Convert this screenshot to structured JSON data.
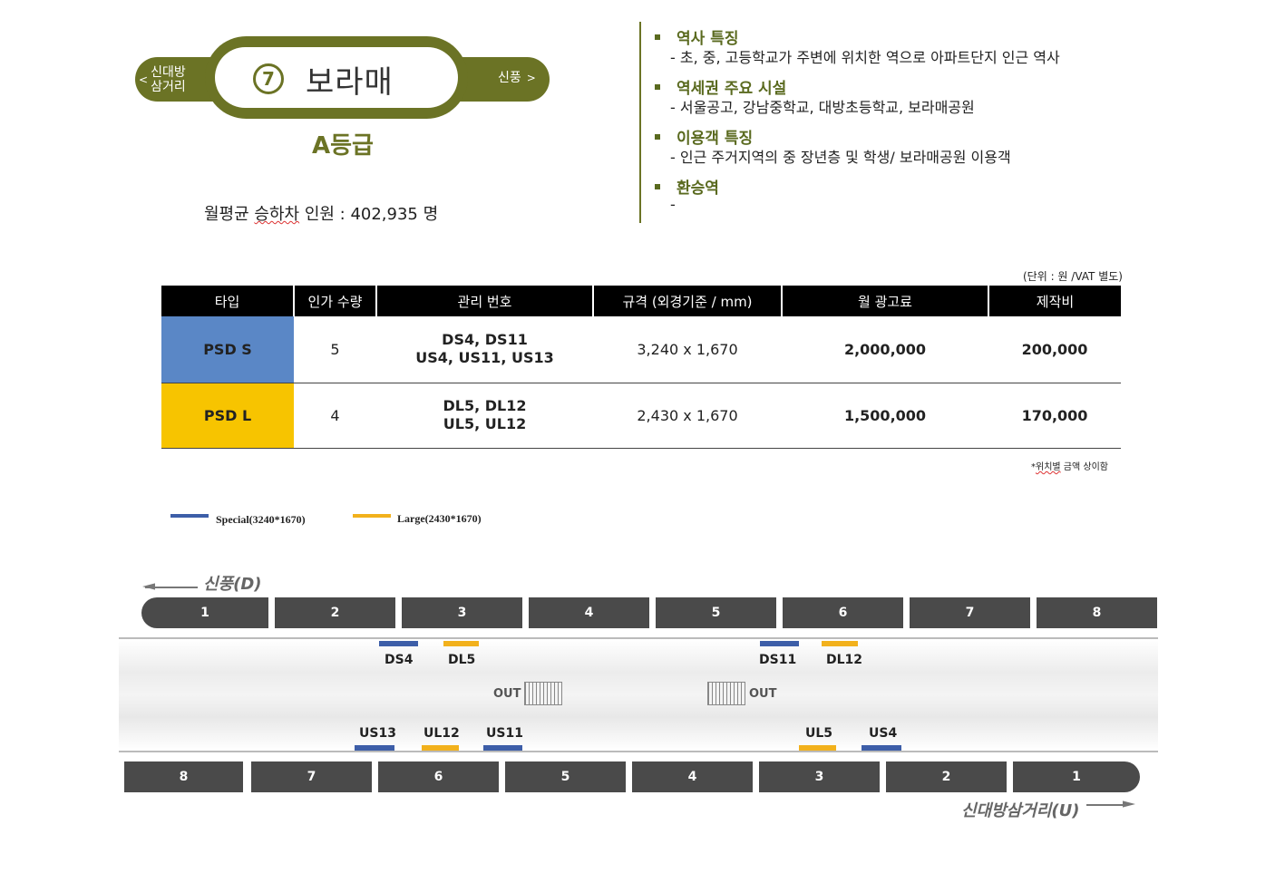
{
  "station": {
    "prev": [
      "신대방",
      "삼거리"
    ],
    "next": "신풍",
    "line_number": "7",
    "name": "보라매",
    "grade": "A등급",
    "monthly_label_pre": "월평균 ",
    "monthly_label_mid": "승하차",
    "monthly_label_post": " 인원 : 402,935 명",
    "line_color": "#6b7325"
  },
  "info": {
    "sections": [
      {
        "title": "역사 특징",
        "body": "-  초, 중, 고등학교가 주변에 위치한 역으로 아파트단지 인근 역사"
      },
      {
        "title": "역세권 주요 시설",
        "body": "-  서울공고, 강남중학교, 대방초등학교, 보라매공원"
      },
      {
        "title": "이용객 특징",
        "body": "-  인근 주거지역의 중 장년층 및 학생/ 보라매공원 이용객"
      },
      {
        "title": "환승역",
        "body": "-"
      }
    ]
  },
  "table": {
    "unit_note": "(단위 : 원 /VAT 별도)",
    "headers": [
      "타입",
      "인가 수량",
      "관리 번호",
      "규격 (외경기준 / mm)",
      "월 광고료",
      "제작비"
    ],
    "rows": [
      {
        "type": "PSD S",
        "qty": "5",
        "mgmt_1": "DS4, DS11",
        "mgmt_2": "US4, US11, US13",
        "size": "3,240 x 1,670",
        "monthly": "2,000,000",
        "production": "200,000",
        "color": "#5a87c6"
      },
      {
        "type": "PSD L",
        "qty": "4",
        "mgmt_1": "DL5, DL12",
        "mgmt_2": "UL5, UL12",
        "size": "2,430 x 1,670",
        "monthly": "1,500,000",
        "production": "170,000",
        "color": "#f7c400"
      }
    ],
    "pos_note_pre": "*",
    "pos_note_mid": "위치별",
    "pos_note_post": " 금액 상이함"
  },
  "legend": {
    "special": "Special(3240*1670)",
    "large": "Large(2430*1670)",
    "special_color": "#3d5ea8",
    "large_color": "#f2b11c"
  },
  "diagram": {
    "dir_top": "신풍(D)",
    "dir_bottom": "신대방삼거리(U)",
    "top_cars": [
      "1",
      "2",
      "3",
      "4",
      "5",
      "6",
      "7",
      "8"
    ],
    "bottom_cars": [
      "8",
      "7",
      "6",
      "5",
      "4",
      "3",
      "2",
      "1"
    ],
    "out": "OUT",
    "top_ads": [
      "DS4",
      "DL5",
      "DS11",
      "DL12"
    ],
    "bottom_ads": [
      "US13",
      "UL12",
      "US11",
      "UL5",
      "US4"
    ]
  }
}
